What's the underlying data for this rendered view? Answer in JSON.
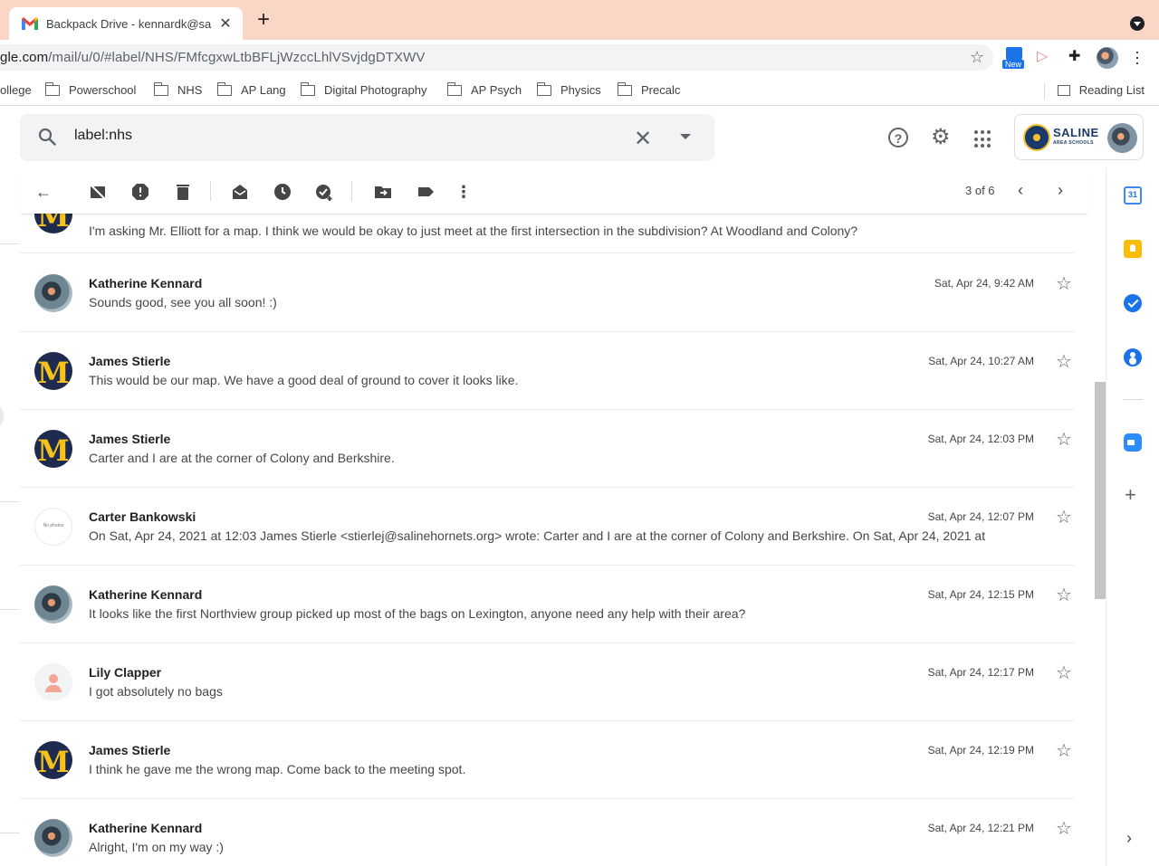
{
  "browser": {
    "tab_title": "Backpack Drive - kennardk@sa",
    "new_tab": "+",
    "url_domain": "gle.com",
    "url_path": "/mail/u/0/#label/NHS/FMfcgxwLtbBFLjWzccLhlVSvjdgDTXWV",
    "ext_badge": "New",
    "bookmarks": [
      "ollege",
      "Powerschool",
      "NHS",
      "AP Lang",
      "Digital Photography",
      "AP Psych",
      "Physics",
      "Precalc"
    ],
    "reading_list": "Reading List"
  },
  "header": {
    "search_query": "label:nhs",
    "org_name": "SALINE",
    "org_sub": "AREA SCHOOLS"
  },
  "toolbar": {
    "pager": "3 of 6"
  },
  "thread": {
    "messages": [
      {
        "sender": "",
        "snippet": "I'm asking Mr. Elliott for a map. I think we would be okay to just meet at the first intersection in the subdivision? At Woodland and Colony?",
        "date": "",
        "avatar": "m"
      },
      {
        "sender": "Katherine Kennard",
        "snippet": "Sounds good, see you all soon! :)",
        "date": "Sat, Apr 24, 9:42 AM",
        "avatar": "k"
      },
      {
        "sender": "James Stierle",
        "snippet": "This would be our map. We have a good deal of ground to cover it looks like.",
        "date": "Sat, Apr 24, 10:27 AM",
        "avatar": "m"
      },
      {
        "sender": "James Stierle",
        "snippet": "Carter and I are at the corner of Colony and Berkshire.",
        "date": "Sat, Apr 24, 12:03 PM",
        "avatar": "m"
      },
      {
        "sender": "Carter Bankowski",
        "snippet": "On Sat, Apr 24, 2021 at 12:03 James Stierle <stierlej@salinehornets.org> wrote: Carter and I are at the corner of Colony and Berkshire. On Sat, Apr 24, 2021 at",
        "date": "Sat, Apr 24, 12:07 PM",
        "avatar": "c"
      },
      {
        "sender": "Katherine Kennard",
        "snippet": "It looks like the first Northview group picked up most of the bags on Lexington, anyone need any help with their area?",
        "date": "Sat, Apr 24, 12:15 PM",
        "avatar": "k"
      },
      {
        "sender": "Lily Clapper",
        "snippet": "I got absolutely no bags",
        "date": "Sat, Apr 24, 12:17 PM",
        "avatar": "l"
      },
      {
        "sender": "James Stierle",
        "snippet": "I think he gave me the wrong map. Come back to the meeting spot.",
        "date": "Sat, Apr 24, 12:19 PM",
        "avatar": "m"
      },
      {
        "sender": "Katherine Kennard",
        "snippet": "Alright, I'm on my way :)",
        "date": "Sat, Apr 24, 12:21 PM",
        "avatar": "k"
      }
    ],
    "no_photos_label": "No photos"
  },
  "side_panel": {
    "calendar_day": "31"
  }
}
